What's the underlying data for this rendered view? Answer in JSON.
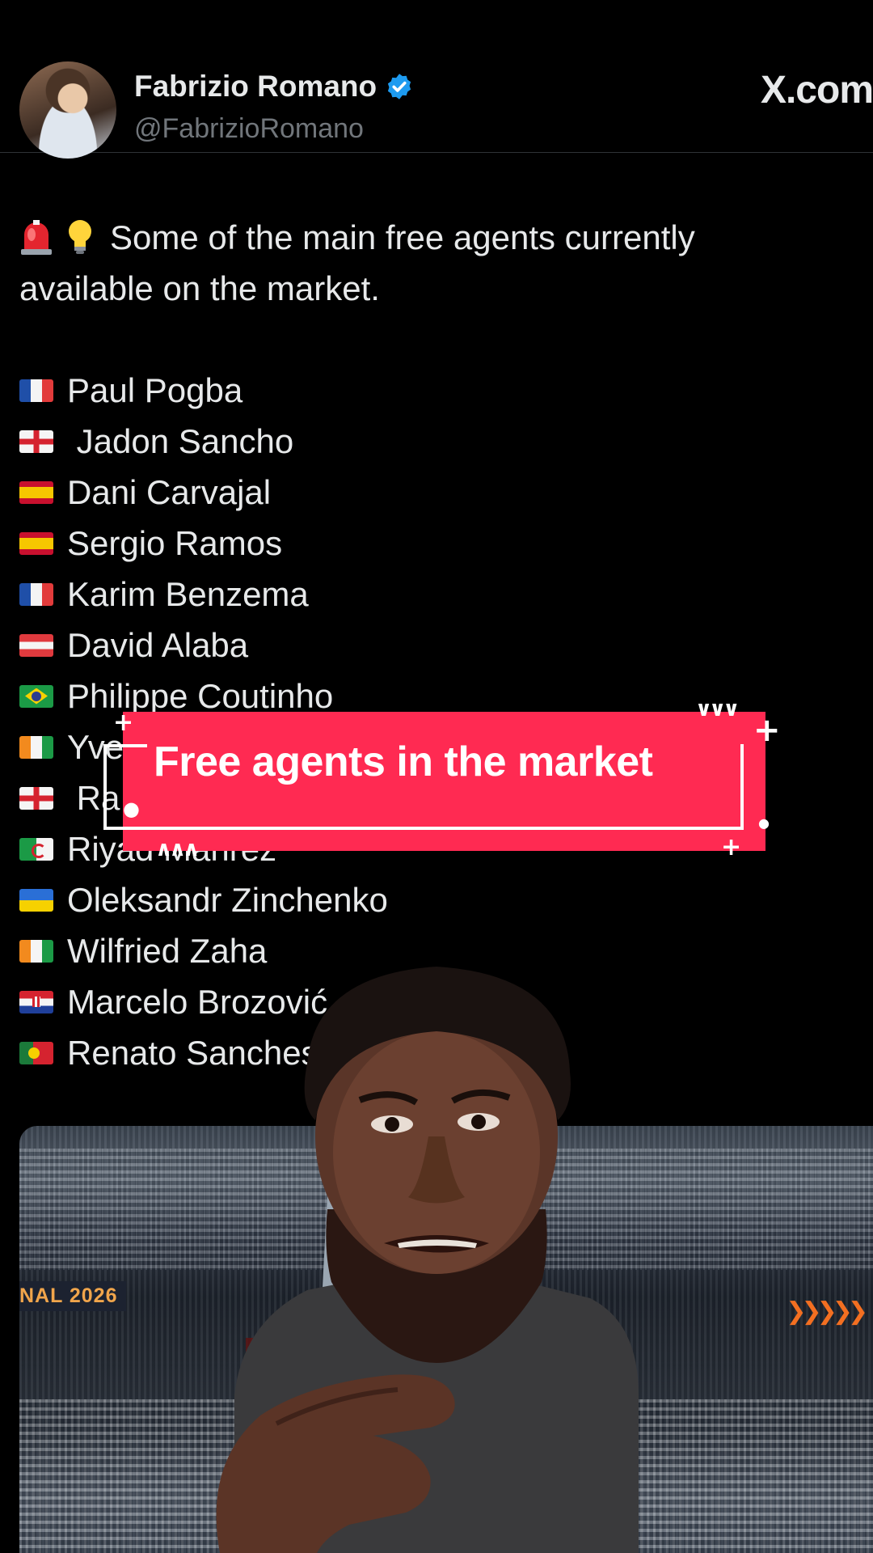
{
  "header": {
    "name": "Fabrizio Romano",
    "handle": "@FabrizioRomano",
    "site": "X.com",
    "site_icon": "x-logo-icon",
    "verified_icon": "verified-badge-icon"
  },
  "tweet": {
    "intro": "Some of the main free agents currently",
    "intro_line2": "available on the market.",
    "intro_icons": [
      "siren-emoji",
      "light-bulb-emoji"
    ],
    "players": [
      {
        "flag": "France",
        "name": "Paul Pogba"
      },
      {
        "flag": "England",
        "name": " Jadon Sancho"
      },
      {
        "flag": "Spain",
        "name": "Dani Carvajal"
      },
      {
        "flag": "Spain",
        "name": "Sergio Ramos"
      },
      {
        "flag": "France",
        "name": "Karim Benzema"
      },
      {
        "flag": "Austria",
        "name": "David Alaba"
      },
      {
        "flag": "Brazil",
        "name": "Philippe Coutinho"
      },
      {
        "flag": "Ivory Coast",
        "name": "Yve"
      },
      {
        "flag": "England",
        "name": " Ra"
      },
      {
        "flag": "Algeria",
        "name": "Riyad Mahrez"
      },
      {
        "flag": "Ukraine",
        "name": "Oleksandr Zinchenko"
      },
      {
        "flag": "Ivory Coast",
        "name": "Wilfried Zaha"
      },
      {
        "flag": "Croatia",
        "name": "Marcelo Brozović"
      },
      {
        "flag": "Portugal",
        "name": "Renato Sanches"
      }
    ]
  },
  "banner": {
    "text": "Free agents in the market",
    "color": "#ff2a52"
  },
  "media": {
    "sign_text": "NAL 2026"
  },
  "colors": {
    "background": "#000000",
    "text": "#e7e9ea",
    "handle": "#71767b",
    "verified": "#1d9bf0"
  }
}
